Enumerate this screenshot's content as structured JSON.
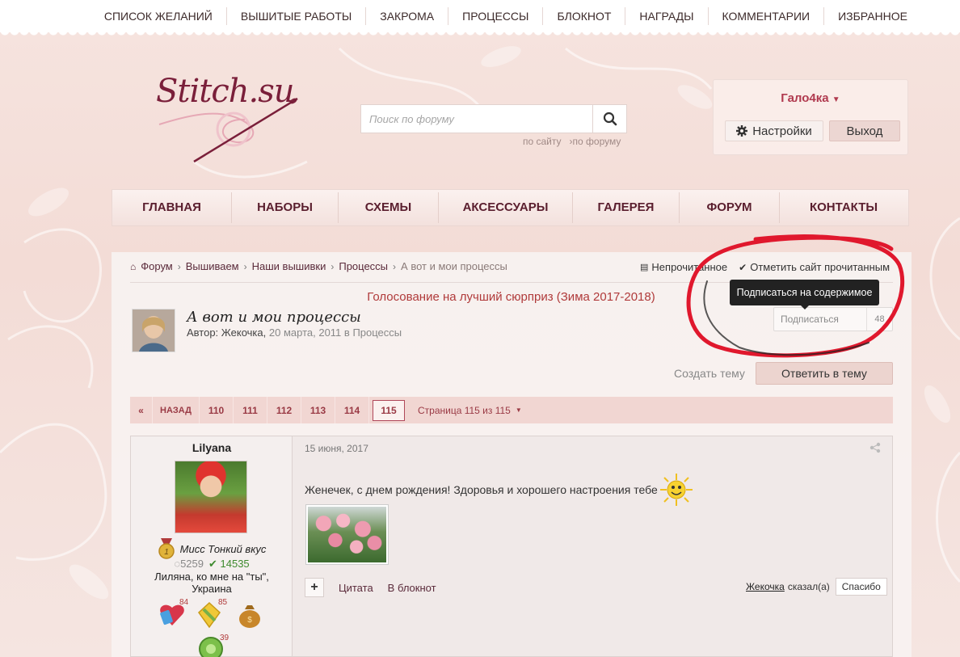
{
  "top_nav": [
    "СПИСОК ЖЕЛАНИЙ",
    "ВЫШИТЫЕ РАБОТЫ",
    "ЗАКРОМА",
    "ПРОЦЕССЫ",
    "БЛОКНОТ",
    "НАГРАДЫ",
    "КОММЕНТАРИИ",
    "ИЗБРАННОЕ"
  ],
  "logo": {
    "text": "Stitch.su"
  },
  "search": {
    "placeholder": "Поиск по форуму",
    "scope_site": "по сайту",
    "scope_forum": "по форуму"
  },
  "user": {
    "name": "Гало4ка",
    "settings_label": "Настройки",
    "logout_label": "Выход"
  },
  "main_nav": [
    "ГЛАВНАЯ",
    "НАБОРЫ",
    "СХЕМЫ",
    "АКСЕССУАРЫ",
    "ГАЛЕРЕЯ",
    "ФОРУМ",
    "КОНТАКТЫ"
  ],
  "breadcrumb": [
    "Форум",
    "Вышиваем",
    "Наши вышивки",
    "Процессы",
    "А вот и мои процессы"
  ],
  "unread": {
    "unread_label": "Непрочитанное",
    "mark_read_label": "Отметить сайт прочитанным"
  },
  "vote_banner": "Голосование на лучший сюрприз (Зима 2017-2018)",
  "topic": {
    "title": "А вот и мои процессы",
    "author_prefix": "Автор:",
    "author": "Жекочка",
    "date": "20 марта, 2011",
    "in_label": "в",
    "category": "Процессы"
  },
  "subscribe": {
    "label": "Подписаться",
    "count": "48",
    "tooltip": "Подписаться на содержимое"
  },
  "actions": {
    "create_topic": "Создать тему",
    "reply": "Ответить в тему"
  },
  "pagination": {
    "first": "«",
    "back": "НАЗАД",
    "pages": [
      "110",
      "111",
      "112",
      "113",
      "114"
    ],
    "current": "115",
    "info": "Страница 115 из 115"
  },
  "post": {
    "author": "Lilyana",
    "rank": "Мисс Тонкий вкус",
    "rank_num": "1",
    "posts": "5259",
    "reputation": "14535",
    "location_line1": "Лиляна, ко мне на \"ты\",",
    "location_line2": "Украина",
    "badge_counts": [
      "84",
      "85",
      "39"
    ],
    "date": "15 июня, 2017",
    "text": "Женечек, с днем рождения! Здоровья и хорошего настроения тебе",
    "quote_label": "Цитата",
    "notebook_label": "В блокнот",
    "thanks_user": "Жекочка",
    "thanks_said": "сказал(а)",
    "thanks_button": "Спасибо"
  },
  "colors": {
    "brand": "#7a1f3a",
    "accent_red": "#b03a3a",
    "background": "#f3dcd6",
    "annotation_circle": "#e0182d"
  }
}
